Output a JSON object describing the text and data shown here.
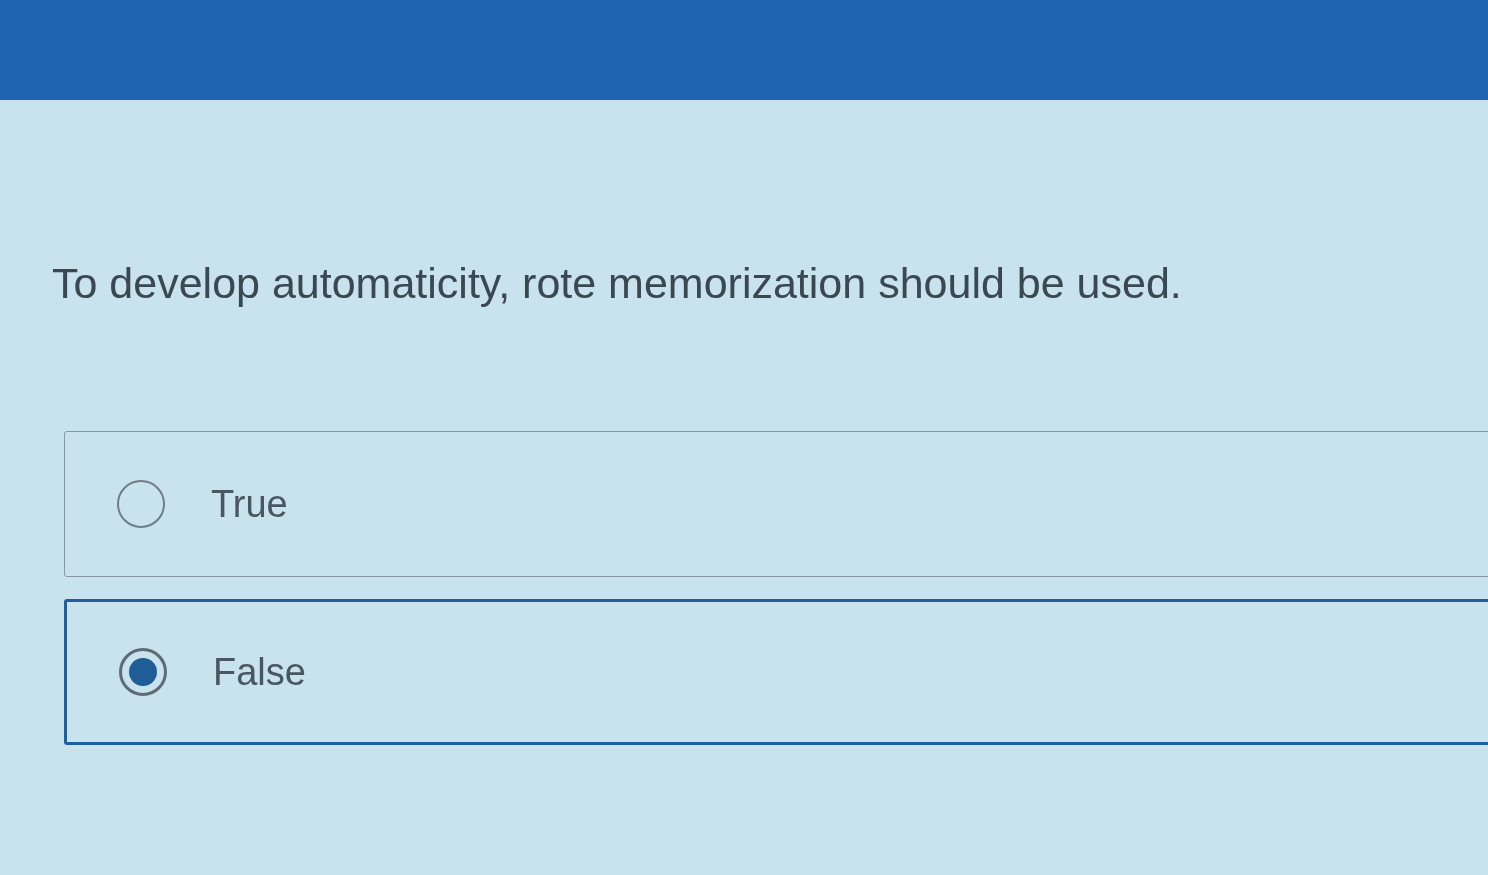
{
  "question": {
    "text": "To develop automaticity, rote memorization should be used.",
    "options": [
      {
        "label": "True",
        "selected": false
      },
      {
        "label": "False",
        "selected": true
      }
    ]
  }
}
